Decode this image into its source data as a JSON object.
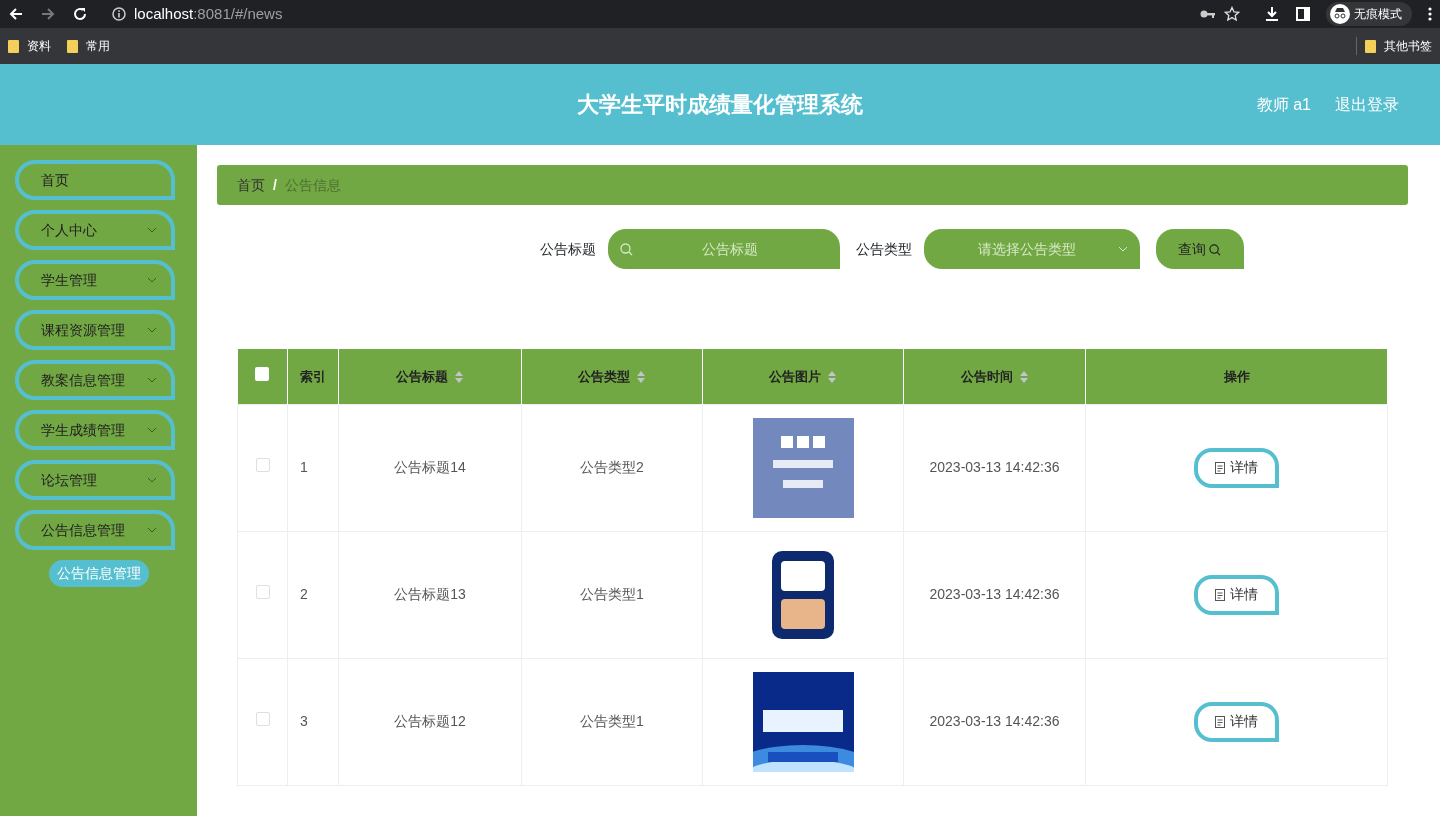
{
  "browser": {
    "url_host": "localhost",
    "url_rest": ":8081/#/news",
    "profile": "无痕模式",
    "bookmarks": [
      "资料",
      "常用"
    ],
    "other_bookmarks": "其他书签"
  },
  "header": {
    "title": "大学生平时成绩量化管理系统",
    "user": "教师 a1",
    "logout": "退出登录"
  },
  "sidebar": {
    "items": [
      {
        "label": "首页",
        "expandable": false
      },
      {
        "label": "个人中心",
        "expandable": true
      },
      {
        "label": "学生管理",
        "expandable": true
      },
      {
        "label": "课程资源管理",
        "expandable": true
      },
      {
        "label": "教案信息管理",
        "expandable": true
      },
      {
        "label": "学生成绩管理",
        "expandable": true
      },
      {
        "label": "论坛管理",
        "expandable": true
      },
      {
        "label": "公告信息管理",
        "expandable": true,
        "children": [
          {
            "label": "公告信息管理",
            "selected": true
          }
        ]
      }
    ]
  },
  "breadcrumb": [
    "首页",
    "公告信息"
  ],
  "breadcrumb_separator": "/",
  "search": {
    "fields": [
      {
        "label": "公告标题",
        "placeholder": "公告标题",
        "kind": "text"
      },
      {
        "label": "公告类型",
        "placeholder": "请选择公告类型",
        "kind": "select"
      }
    ],
    "button": "查询"
  },
  "table": {
    "all_checked": false,
    "columns": [
      {
        "label": "索引",
        "sortable": false
      },
      {
        "label": "公告标题",
        "sortable": true
      },
      {
        "label": "公告类型",
        "sortable": true
      },
      {
        "label": "公告图片",
        "sortable": true
      },
      {
        "label": "公告时间",
        "sortable": true
      },
      {
        "label": "操作",
        "sortable": false
      }
    ],
    "rows": [
      {
        "checked": false,
        "index": "1",
        "title": "公告标题14",
        "type": "公告类型2",
        "time": "2023-03-13 14:42:36",
        "action": "详情"
      },
      {
        "checked": false,
        "index": "2",
        "title": "公告标题13",
        "type": "公告类型1",
        "time": "2023-03-13 14:42:36",
        "action": "详情"
      },
      {
        "checked": false,
        "index": "3",
        "title": "公告标题12",
        "type": "公告类型1",
        "time": "2023-03-13 14:42:36",
        "action": "详情"
      }
    ]
  }
}
